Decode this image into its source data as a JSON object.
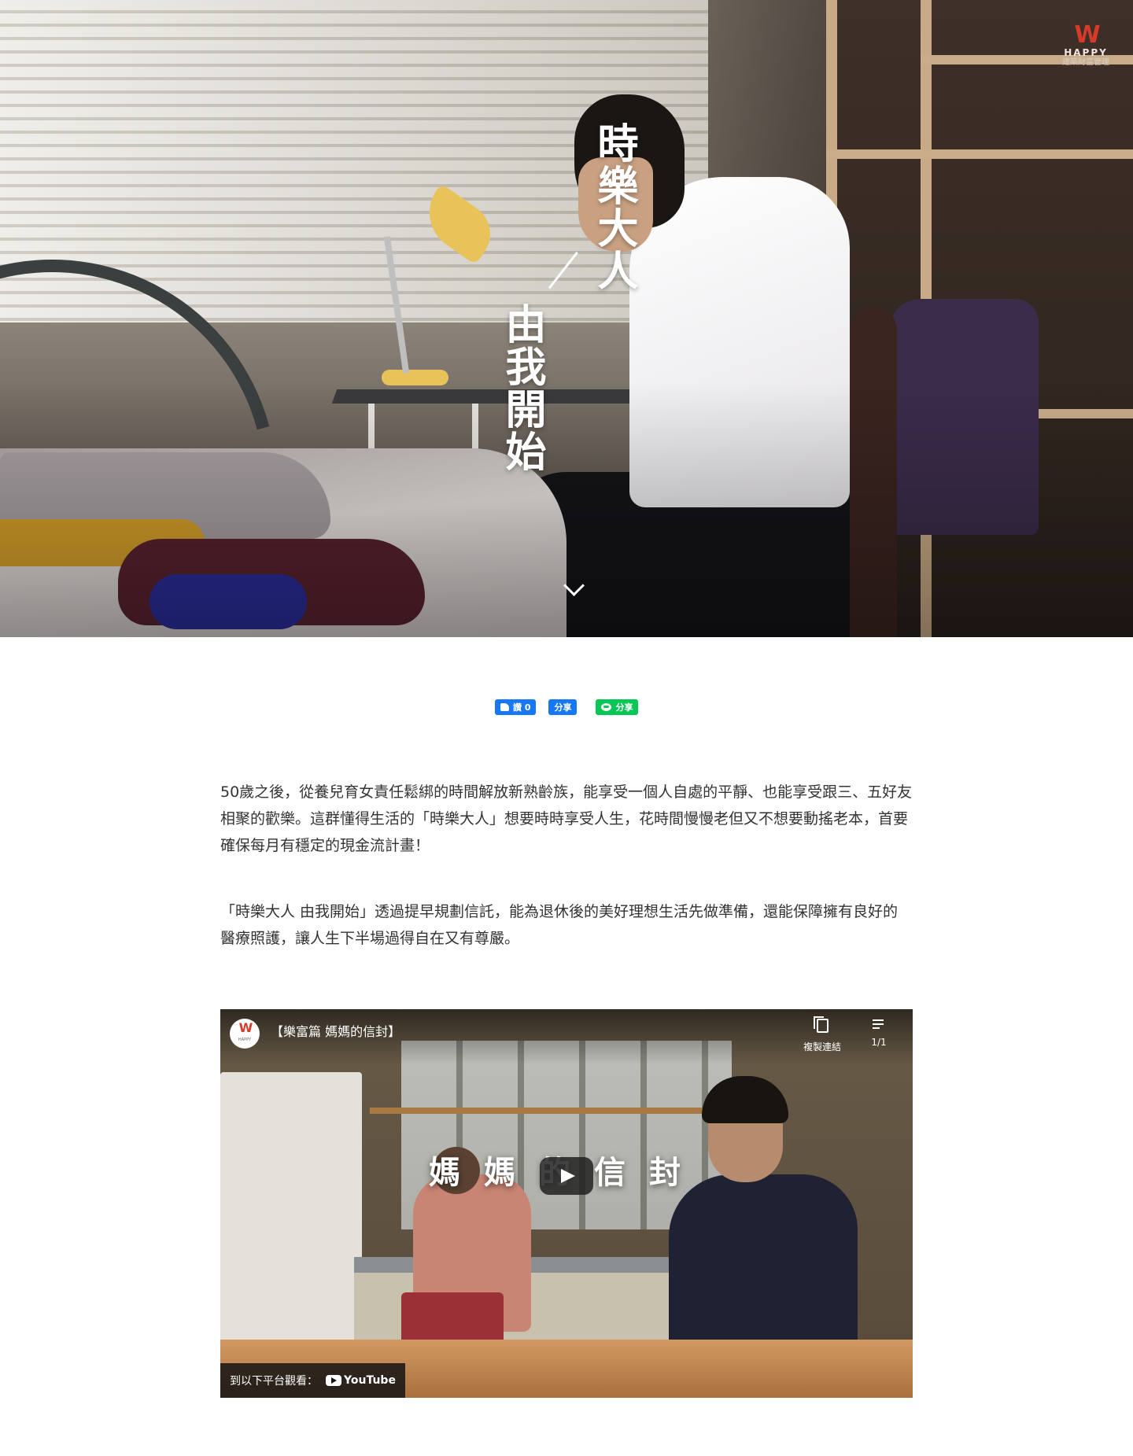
{
  "hero": {
    "title_line1": "時樂大人",
    "title_line2": "由我開始",
    "scroll_hint_icon": "chevron-down-icon"
  },
  "logo": {
    "mark": "W",
    "brand": "HAPPY",
    "subtitle": "建築財富管理"
  },
  "social": {
    "like_label": "讚 0",
    "share_label": "分享",
    "line_share_label": "分享",
    "colors": {
      "facebook": "#1877f2",
      "line": "#06c755"
    }
  },
  "article": {
    "paragraphs": [
      "50歲之後，從養兒育女責任鬆綁的時間解放新熟齡族，能享受一個人自處的平靜、也能享受跟三、五好友相聚的歡樂。這群懂得生活的「時樂大人」想要時時享受人生，花時間慢慢老但又不想要動搖老本，首要確保每月有穩定的現金流計畫！",
      "「時樂大人 由我開始」透過提早規劃信託，能為退休後的美好理想生活先做準備，還能保障擁有良好的醫療照護，讓人生下半場過得自在又有尊嚴。"
    ]
  },
  "video": {
    "title": "【樂富篇 媽媽的信封】",
    "copy_link_label": "複製連結",
    "playlist_count": "1/1",
    "overlay_text": "媽媽的信封",
    "watch_on_label": "到以下平台觀看：",
    "platform": "YouTube"
  }
}
